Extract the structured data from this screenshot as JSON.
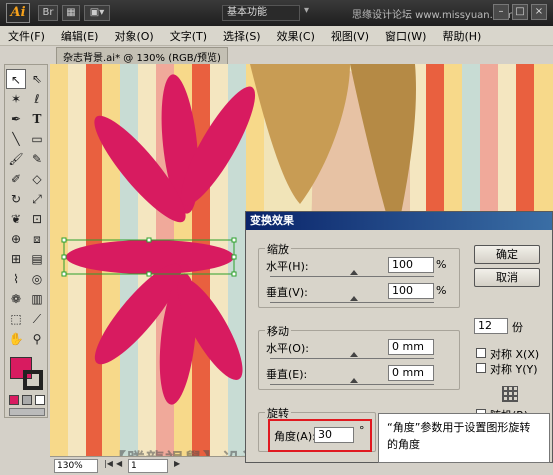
{
  "app": {
    "logo": "Ai",
    "workspace": "基本功能",
    "top_watermark": "思缘设计论坛 www.missyuan.com"
  },
  "menu": [
    "文件(F)",
    "编辑(E)",
    "对象(O)",
    "文字(T)",
    "选择(S)",
    "效果(C)",
    "视图(V)",
    "窗口(W)",
    "帮助(H)"
  ],
  "document": {
    "tab_label": "杂志背景.ai* @ 130% (RGB/预览)"
  },
  "status": {
    "zoom": "130%",
    "page": "1"
  },
  "dialog": {
    "title": "变换效果",
    "scale": {
      "label": "缩放",
      "h_label": "水平(H):",
      "h_value": "100",
      "h_unit": "%",
      "v_label": "垂直(V):",
      "v_value": "100",
      "v_unit": "%"
    },
    "move": {
      "label": "移动",
      "h_label": "水平(O):",
      "h_value": "0 mm",
      "v_label": "垂直(E):",
      "v_value": "0 mm"
    },
    "rotate": {
      "label": "旋转",
      "angle_label": "角度(A):",
      "angle_value": "30",
      "angle_unit": "°"
    },
    "ok": "确定",
    "cancel": "取消",
    "copies_value": "12",
    "copies_label": "份",
    "reflect_x": "对称 X(X)",
    "reflect_y": "对称 Y(Y)",
    "random": "随机(R)"
  },
  "callout": {
    "text": "“角度”参数用于设置图形旋转的角度"
  },
  "watermark": "【腾龍視覺】设计学院 YY频道ID：80101",
  "colors": {
    "accent_pink": "#d81b60",
    "title_blue": "#0a246a",
    "highlight_red": "#e0191f"
  },
  "icons": [
    "selection-tool-icon",
    "direct-selection-icon",
    "magic-wand-icon",
    "lasso-icon",
    "pen-icon",
    "type-icon",
    "line-icon",
    "rectangle-icon",
    "paintbrush-icon",
    "pencil-icon",
    "blob-brush-icon",
    "eraser-icon",
    "rotate-icon",
    "scale-icon",
    "warp-icon",
    "free-transform-icon",
    "shape-builder-icon",
    "perspective-icon",
    "mesh-icon",
    "gradient-icon",
    "eyedropper-icon",
    "blend-icon",
    "symbol-sprayer-icon",
    "column-graph-icon",
    "artboard-icon",
    "slice-icon",
    "hand-icon",
    "zoom-icon"
  ]
}
